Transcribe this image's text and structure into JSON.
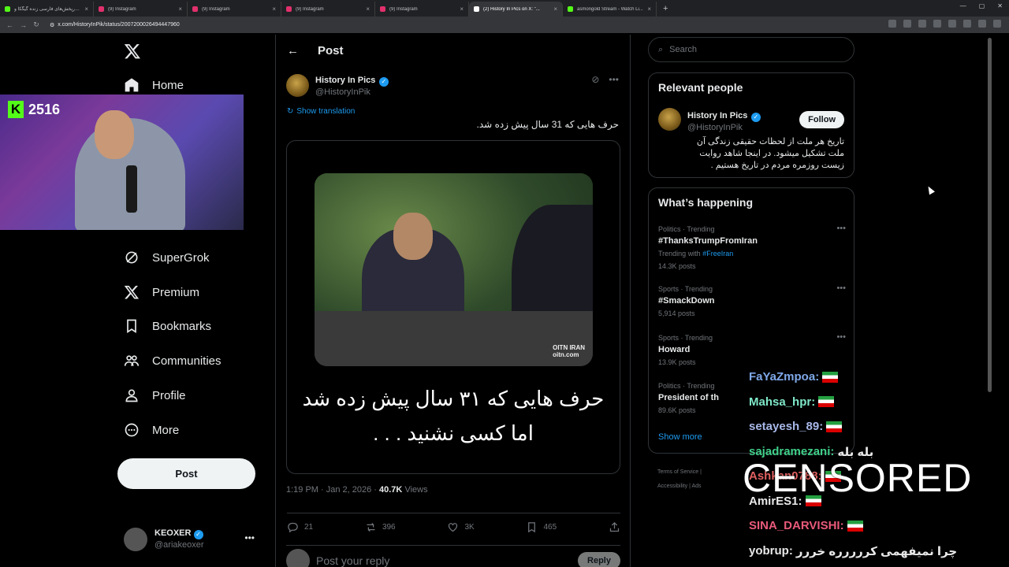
{
  "browser": {
    "tabs": [
      {
        "label": "استارپخش‌های فارسی زنده گیگکا و",
        "color": "#53fc18"
      },
      {
        "label": "(9) Instagram",
        "color": "#e1306c"
      },
      {
        "label": "(9) Instagram",
        "color": "#e1306c"
      },
      {
        "label": "(9) Instagram",
        "color": "#e1306c"
      },
      {
        "label": "(9) Instagram",
        "color": "#e1306c"
      },
      {
        "label": "(2) History In Pics on X: \"...",
        "color": "#ffffff",
        "active": true
      },
      {
        "label": "asmongold Stream - Watch Li...",
        "color": "#53fc18"
      }
    ],
    "url": "x.com/HistoryInPik/status/2007200026494447960"
  },
  "nav": {
    "home": "Home",
    "supergrok": "SuperGrok",
    "premium": "Premium",
    "bookmarks": "Bookmarks",
    "communities": "Communities",
    "profile": "Profile",
    "more": "More",
    "post_button": "Post",
    "me_name": "KEOXER",
    "me_handle": "@ariakeoxer"
  },
  "webcam": {
    "kick_count": "2516"
  },
  "post": {
    "header_title": "Post",
    "author_name": "History In Pics",
    "author_handle": "@HistoryInPik",
    "show_translation": "Show translation",
    "text": "حرف هایی که 31 سال پیش زده شد.",
    "media_caption_line1": "حرف هایی که ۳۱ سال پیش زده شد",
    "media_caption_line2": "اما کسی نشنید . . .",
    "video_logo_1": "OITN IRAN",
    "video_logo_2": "oitn.com",
    "time": "1:19 PM · Jan 2, 2026 ·",
    "views_count": "40.7K",
    "views_label": "Views",
    "replies": "21",
    "reposts": "396",
    "likes": "3K",
    "bookmarks": "465",
    "reply_placeholder": "Post your reply",
    "reply_button": "Reply"
  },
  "sidebar": {
    "search_placeholder": "Search",
    "relevant_title": "Relevant people",
    "rp_name": "History In Pics",
    "rp_handle": "@HistoryInPik",
    "follow": "Follow",
    "rp_bio": "تاریخ هر ملت از لحظات حقیقی زندگی آن ملت تشکیل میشود. در اینجا شاهد روایت زیست روزمره مردم در تاریخ هستیم .",
    "happening_title": "What’s happening",
    "trends": [
      {
        "cat": "Politics · Trending",
        "name": "#ThanksTrumpFromIran",
        "with_label": "Trending with",
        "with_tag": "#FreeIran",
        "count": "14.3K posts"
      },
      {
        "cat": "Sports · Trending",
        "name": "#SmackDown",
        "count": "5,914 posts"
      },
      {
        "cat": "Sports · Trending",
        "name": "Howard",
        "count": "13.9K posts"
      },
      {
        "cat": "Politics · Trending",
        "name": "President of th",
        "count": "89.6K posts"
      }
    ],
    "show_more": "Show more",
    "footer_1": "Terms of Service  |",
    "footer_2": "Accessibility  |  Ads"
  },
  "chat": [
    {
      "user": "FaYaZmpoa:",
      "msg": "",
      "color": "#7fa8e8"
    },
    {
      "user": "Mahsa_hpr:",
      "msg": "",
      "color": "#7fe8c8"
    },
    {
      "user": "setayesh_89:",
      "msg": "",
      "color": "#a8b8e8"
    },
    {
      "user": "sajadramezani:",
      "msg": "بله بله",
      "color": "#3fd08a"
    },
    {
      "user": "Ashkan0788:",
      "msg": "",
      "color": "#e06060"
    },
    {
      "user": "AmirES1:",
      "msg": "",
      "color": "#e8e8e8"
    },
    {
      "user": "SINA_DARVISHI:",
      "msg": "",
      "color": "#e85a7a"
    },
    {
      "user": "yobrup:",
      "msg": "چرا نمیفهمی کررررره خررر",
      "color": "#e8e8e8"
    }
  ],
  "censored": "CENSORED"
}
